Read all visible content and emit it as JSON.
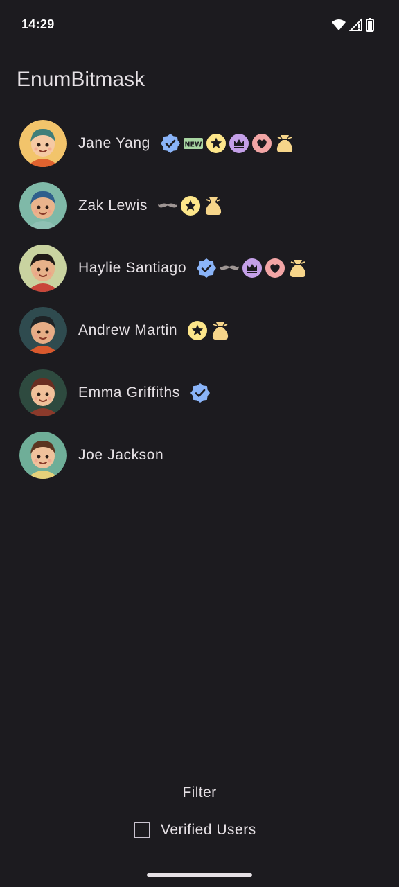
{
  "status_bar": {
    "time": "14:29",
    "icons": [
      "wifi-icon",
      "cellular-signal-icon",
      "battery-icon"
    ]
  },
  "app": {
    "title": "EnumBitmask"
  },
  "users": [
    {
      "name": "Jane Yang",
      "avatar": "girl-teal-hair-avatar",
      "badges": [
        "verified-icon",
        "new-icon",
        "star-icon",
        "crown-icon",
        "heart-icon",
        "money-bag-icon"
      ]
    },
    {
      "name": "Zak Lewis",
      "avatar": "boy-blue-hair-avatar",
      "badges": [
        "mustache-icon",
        "star-icon",
        "money-bag-icon"
      ]
    },
    {
      "name": "Haylie Santiago",
      "avatar": "boy-curly-hair-avatar",
      "badges": [
        "verified-icon",
        "mustache-icon",
        "crown-icon",
        "heart-icon",
        "money-bag-icon"
      ]
    },
    {
      "name": "Andrew Martin",
      "avatar": "boy-spiky-hair-avatar",
      "badges": [
        "star-icon",
        "money-bag-icon"
      ]
    },
    {
      "name": "Emma Griffiths",
      "avatar": "girl-pigtails-avatar",
      "badges": [
        "verified-icon"
      ]
    },
    {
      "name": "Joe Jackson",
      "avatar": "boy-brown-hair-avatar",
      "badges": []
    }
  ],
  "filter": {
    "title": "Filter",
    "verified_label": "Verified Users",
    "verified_checked": false
  },
  "badge_text": {
    "new": "NEW"
  },
  "colors": {
    "background": "#1c1b1f",
    "text": "#e6e1e5",
    "verified": "#8ab4f8",
    "new": "#a8d5a2",
    "star": "#fde68a",
    "crown": "#c4a0e8",
    "heart": "#f2a5a5",
    "money_bag": "#f6d58a",
    "mustache": "#9e9593"
  }
}
